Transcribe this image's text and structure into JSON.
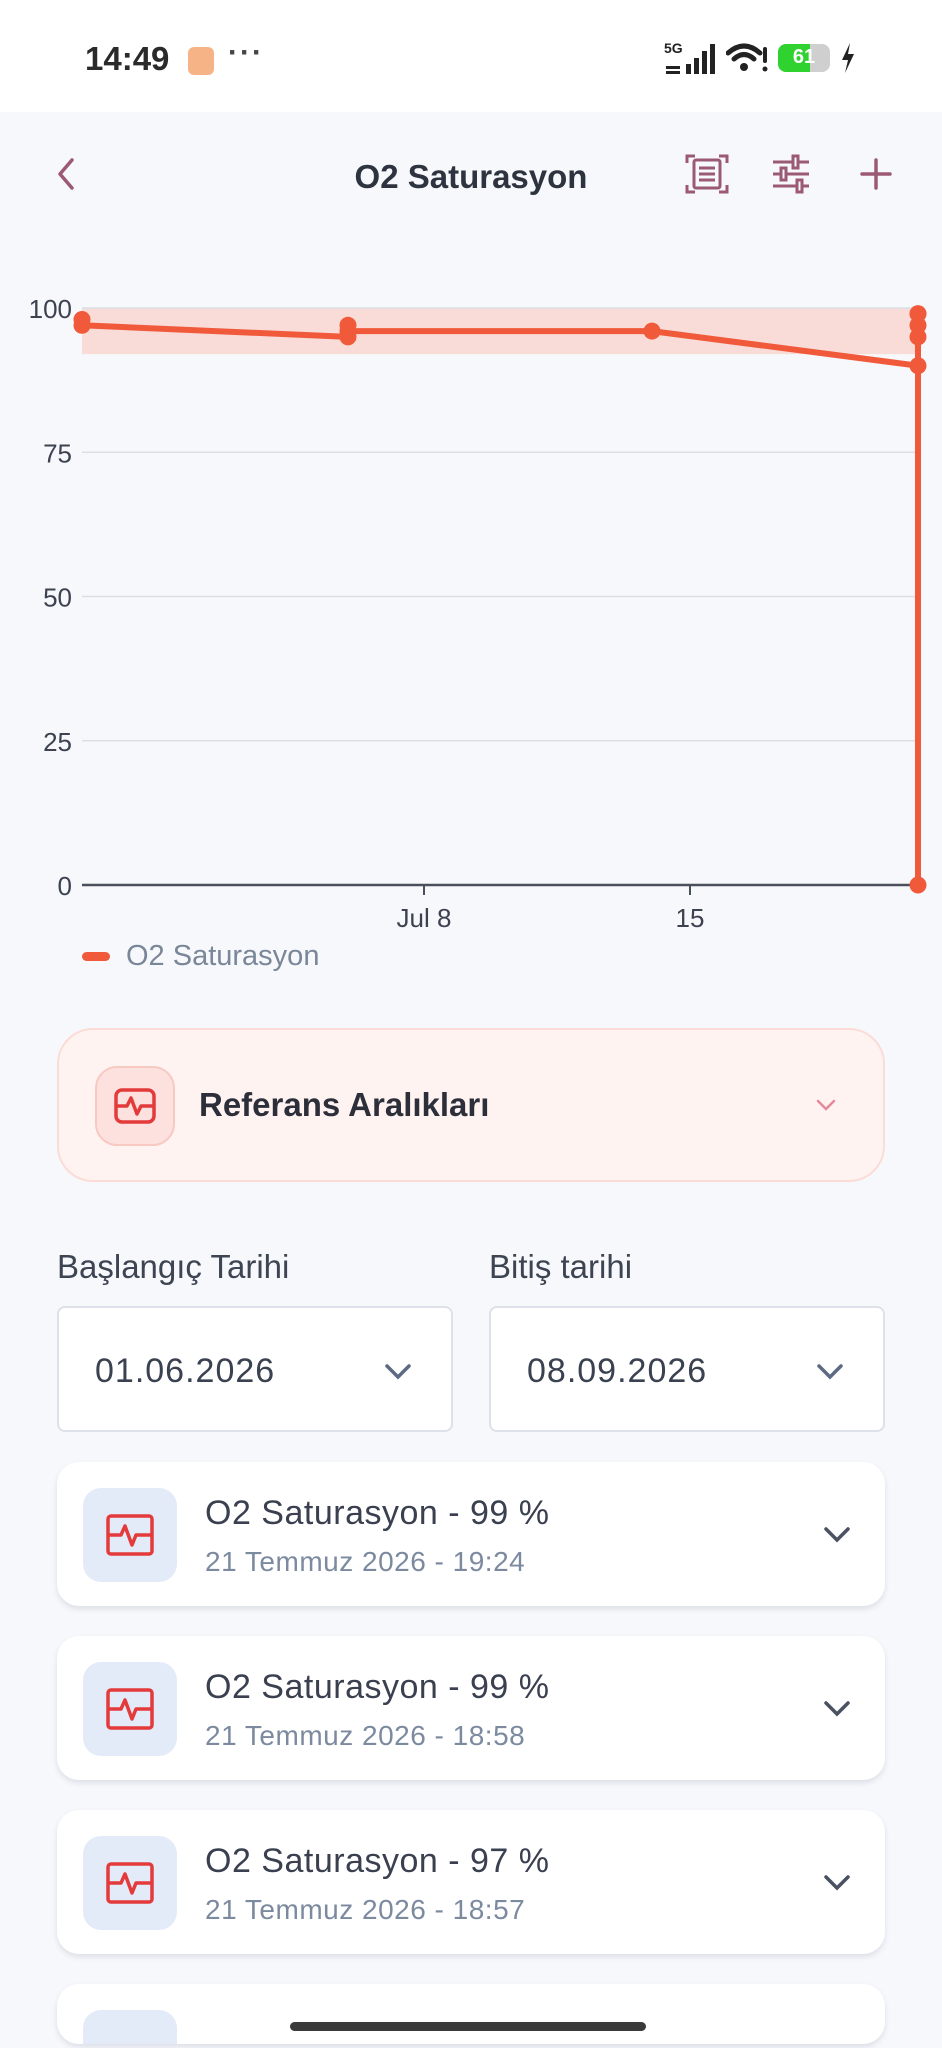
{
  "status_bar": {
    "time": "14:49",
    "dots": "···",
    "network": "5G",
    "battery": "61",
    "icons": [
      "app-notification-icon",
      "signal-icon",
      "wifi-icon",
      "battery-icon",
      "charging-bolt-icon"
    ]
  },
  "header": {
    "title": "O2 Saturasyon",
    "icons": [
      "back-arrow-icon",
      "report-scan-icon",
      "filter-sliders-icon",
      "plus-icon"
    ]
  },
  "colors": {
    "accent": "#f05a3b",
    "reference_band": "#f9dcd8",
    "icon_red": "#e33b3b",
    "header_icon": "#9b5a72"
  },
  "chart_data": {
    "type": "line",
    "series": [
      {
        "name": "O2 Saturasyon",
        "points": [
          {
            "x": "2026-06-29",
            "y": 98
          },
          {
            "x": "2026-06-29",
            "y": 97
          },
          {
            "x": "2026-07-06",
            "y": 95
          },
          {
            "x": "2026-07-06",
            "y": 97
          },
          {
            "x": "2026-07-06",
            "y": 96
          },
          {
            "x": "2026-07-14",
            "y": 96
          },
          {
            "x": "2026-07-21",
            "y": 90
          },
          {
            "x": "2026-07-21",
            "y": 97
          },
          {
            "x": "2026-07-21",
            "y": 95
          },
          {
            "x": "2026-07-21",
            "y": 99
          },
          {
            "x": "2026-07-21",
            "y": 99
          },
          {
            "x": "2026-07-21",
            "y": 0
          }
        ]
      }
    ],
    "reference_range": [
      92,
      100
    ],
    "x_ticks": [
      "Jul 8",
      "15"
    ],
    "y_ticks": [
      "0",
      "25",
      "50",
      "75",
      "100"
    ],
    "ylim": [
      0,
      100
    ],
    "grid": true,
    "legend": "bottom-left"
  },
  "reference_card": {
    "title": "Referans Aralıkları",
    "icon": "heart-rate-monitor-icon"
  },
  "filters": {
    "start_label": "Başlangıç Tarihi",
    "start_value": "01.06.2026",
    "end_label": "Bitiş tarihi",
    "end_value": "08.09.2026"
  },
  "records": [
    {
      "title": "O2 Saturasyon - 99 %",
      "date": "21 Temmuz 2026 - 19:24"
    },
    {
      "title": "O2 Saturasyon - 99 %",
      "date": "21 Temmuz 2026 - 18:58"
    },
    {
      "title": "O2 Saturasyon - 97 %",
      "date": "21 Temmuz 2026 - 18:57"
    }
  ]
}
